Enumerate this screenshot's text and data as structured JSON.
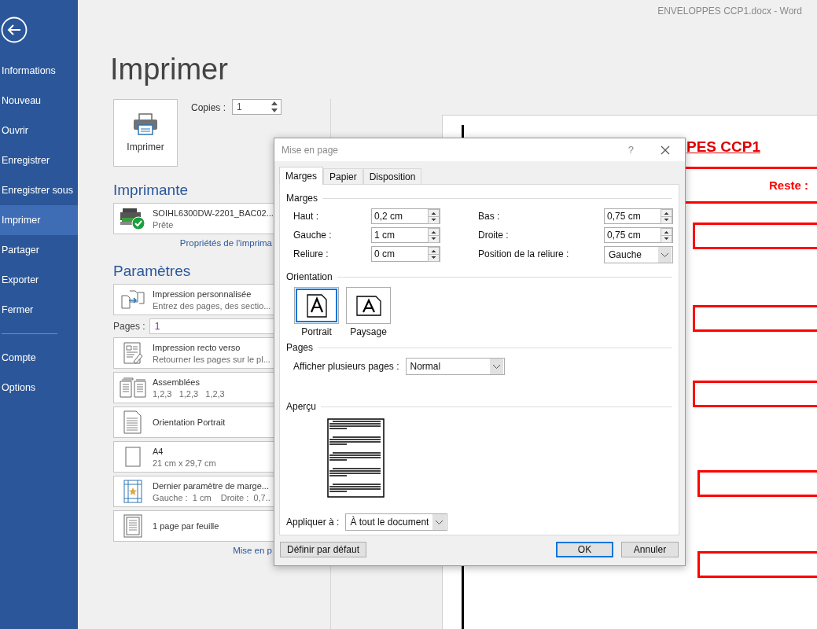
{
  "window": {
    "title": "ENVELOPPES CCP1.docx - Word"
  },
  "sidebar": {
    "items": [
      {
        "label": "Informations",
        "selected": false
      },
      {
        "label": "Nouveau",
        "selected": false
      },
      {
        "label": "Ouvrir",
        "selected": false
      },
      {
        "label": "Enregistrer",
        "selected": false
      },
      {
        "label": "Enregistrer sous",
        "selected": false
      },
      {
        "label": "Imprimer",
        "selected": true
      },
      {
        "label": "Partager",
        "selected": false
      },
      {
        "label": "Exporter",
        "selected": false
      },
      {
        "label": "Fermer",
        "selected": false
      }
    ],
    "footer_items": [
      {
        "label": "Compte",
        "selected": false
      },
      {
        "label": "Options",
        "selected": false
      }
    ]
  },
  "print_panel": {
    "title": "Imprimer",
    "print_button": "Imprimer",
    "copies_label": "Copies :",
    "copies_value": "1",
    "printer_heading": "Imprimante",
    "printer": {
      "name": "SOIHL6300DW-2201_BAC02...",
      "status": "Prête"
    },
    "printer_properties_link": "Propriétés de l'imprima",
    "settings_heading": "Paramètres",
    "settings": [
      {
        "kind": "range",
        "title": "Impression personnalisée",
        "subtitle": "Entrez des pages, des sectio..."
      },
      {
        "kind": "field",
        "label": "Pages :",
        "value": "1"
      },
      {
        "kind": "duplex",
        "title": "Impression recto verso",
        "subtitle": "Retourner les pages sur le pl..."
      },
      {
        "kind": "collate",
        "title": "Assemblées",
        "subtitle": "1,2,3   1,2,3   1,2,3"
      },
      {
        "kind": "orientation",
        "title": "Orientation Portrait"
      },
      {
        "kind": "paper",
        "title": "A4",
        "subtitle": "21 cm x 29,7 cm"
      },
      {
        "kind": "margins",
        "title": "Dernier paramètre de marge...",
        "subtitle": "Gauche :  1 cm    Droite :  0,7.."
      },
      {
        "kind": "per-sheet",
        "title": "1 page par feuille"
      }
    ],
    "page_setup_link": "Mise en p"
  },
  "document": {
    "heading": "PES CCP1",
    "remaining_label": "Reste :"
  },
  "dialog": {
    "title": "Mise en page",
    "help": "?",
    "tabs": [
      {
        "label": "Marges",
        "selected": true
      },
      {
        "label": "Papier",
        "selected": false
      },
      {
        "label": "Disposition",
        "selected": false
      }
    ],
    "margins_heading": "Marges",
    "left_fields": [
      {
        "kind": "spin",
        "label": "Haut :",
        "value": "0,2 cm"
      },
      {
        "kind": "spin",
        "label": "Gauche :",
        "value": "1 cm"
      },
      {
        "kind": "spin",
        "label": "Reliure :",
        "value": "0 cm"
      }
    ],
    "right_fields": [
      {
        "kind": "spin",
        "label": "Bas :",
        "value": "0,75 cm"
      },
      {
        "kind": "spin",
        "label": "Droite :",
        "value": "0,75 cm"
      },
      {
        "kind": "select",
        "label": "Position de la reliure :",
        "value": "Gauche"
      }
    ],
    "orientation_heading": "Orientation",
    "orientations": [
      {
        "kind": "portrait",
        "label": "Portrait",
        "selected": true
      },
      {
        "kind": "landscape",
        "label": "Paysage",
        "selected": false
      }
    ],
    "pages_heading": "Pages",
    "multiple_pages": {
      "label": "Afficher plusieurs pages :",
      "value": "Normal"
    },
    "preview_heading": "Aperçu",
    "apply_to": {
      "label": "Appliquer à :",
      "value": "À tout le document"
    },
    "buttons": [
      {
        "kind": "secondary",
        "label": "Définir par défaut"
      },
      {
        "kind": "default",
        "label": "OK"
      },
      {
        "kind": "secondary",
        "label": "Annuler"
      }
    ]
  }
}
